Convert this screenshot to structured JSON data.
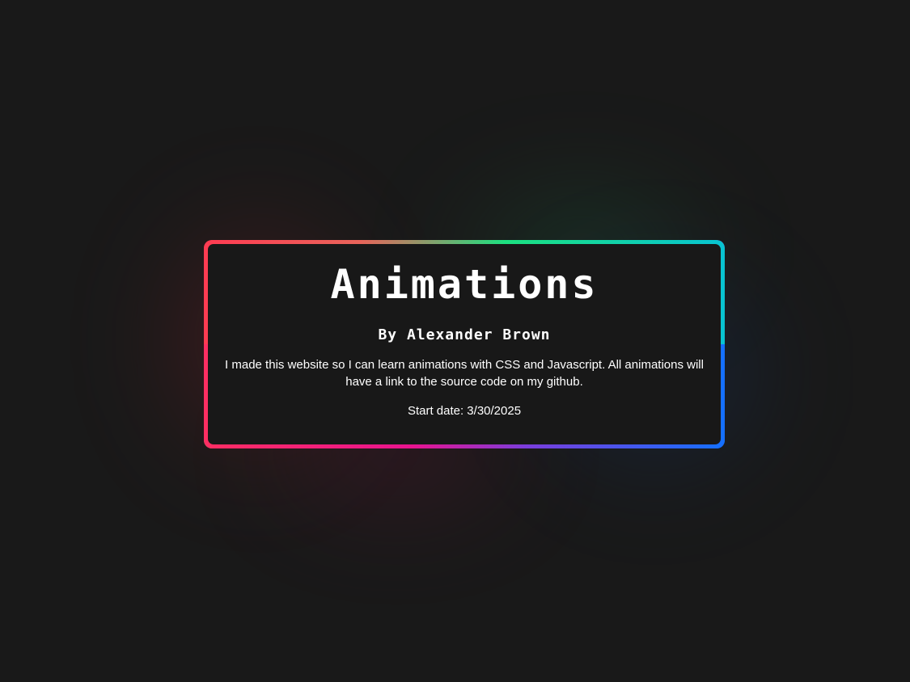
{
  "page": {
    "title": "Animations",
    "author": "By Alexander Brown",
    "description": "I made this website so I can learn animations with CSS and Javascript. All animations will have a link to the source code on my github.",
    "start_date": "Start date: 3/30/2025"
  },
  "colors": {
    "background": "#191919",
    "card_background": "#181818",
    "text": "#ffffff",
    "border_red": "#ff3b52",
    "border_green": "#1ce080",
    "border_cyan": "#08c4d2",
    "border_magenta": "#e8138f",
    "border_blue": "#1470ff"
  }
}
